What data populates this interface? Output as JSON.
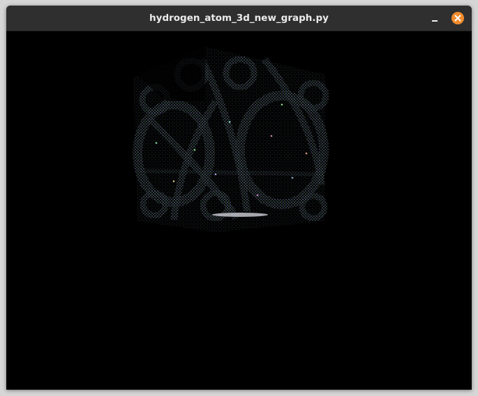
{
  "window": {
    "title": "hydrogen_atom_3d_new_graph.py"
  },
  "controls": {
    "minimize_icon": "minimize-icon",
    "close_icon": "close-icon",
    "close_color": "#f08c2c"
  },
  "plot": {
    "background": "#000000",
    "description_icon": "orbital-point-cloud"
  }
}
